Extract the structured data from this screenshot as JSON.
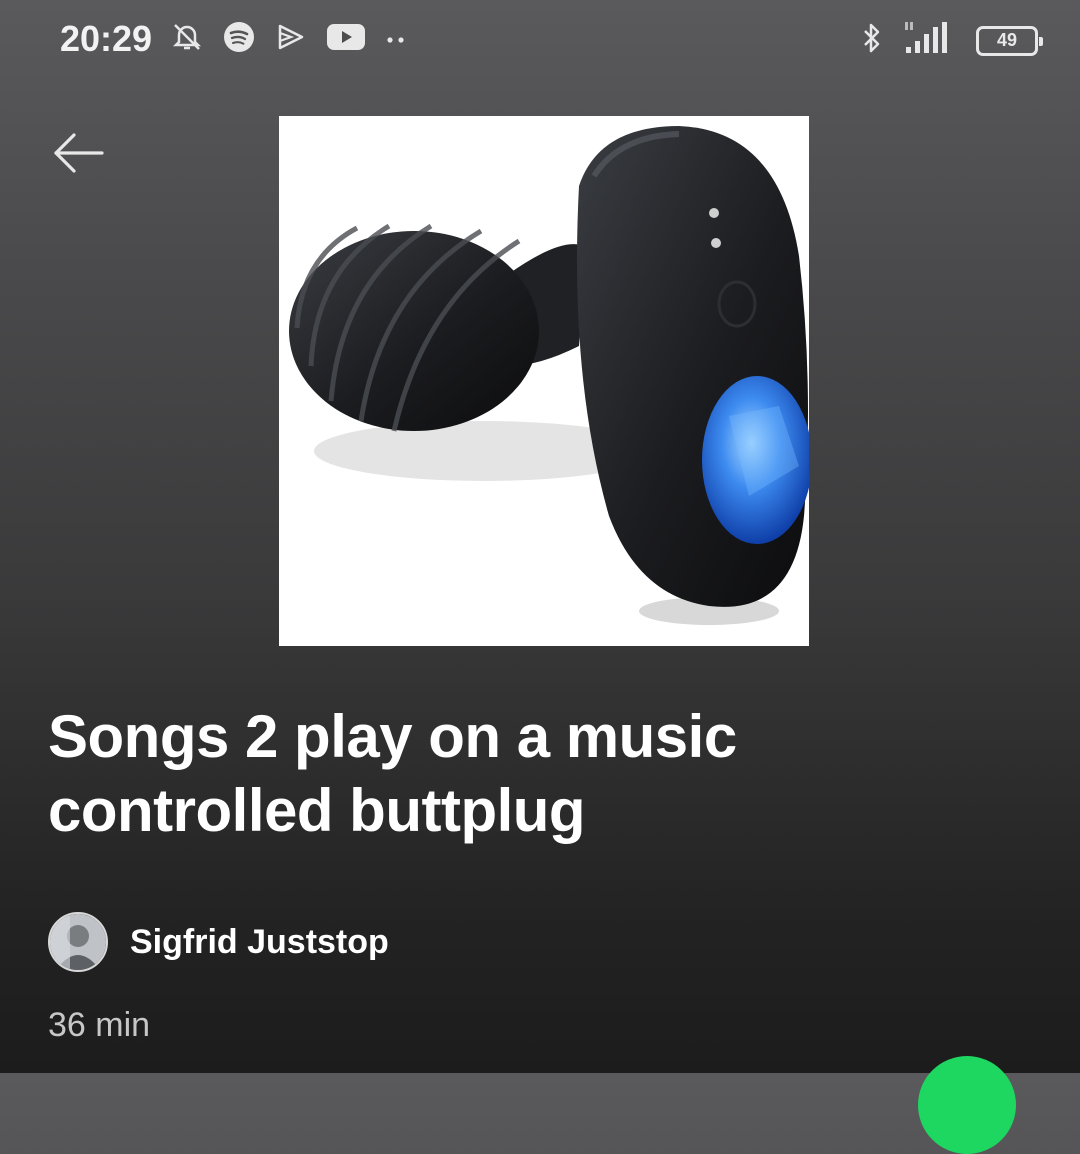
{
  "status_bar": {
    "time": "20:29",
    "left_icons": [
      "mute-icon",
      "spotify-icon",
      "cast-icon",
      "youtube-icon",
      "more-dots-icon"
    ],
    "right_icons": [
      "bluetooth-icon",
      "signal-icon"
    ],
    "battery_level": "49"
  },
  "playlist": {
    "title": "Songs 2 play on a music controlled buttplug",
    "owner": "Sigfrid Juststop",
    "duration": "36 min"
  },
  "colors": {
    "play_button": "#1ed760",
    "background_top": "#5a5a5c",
    "background_bottom": "#1c1c1c"
  }
}
